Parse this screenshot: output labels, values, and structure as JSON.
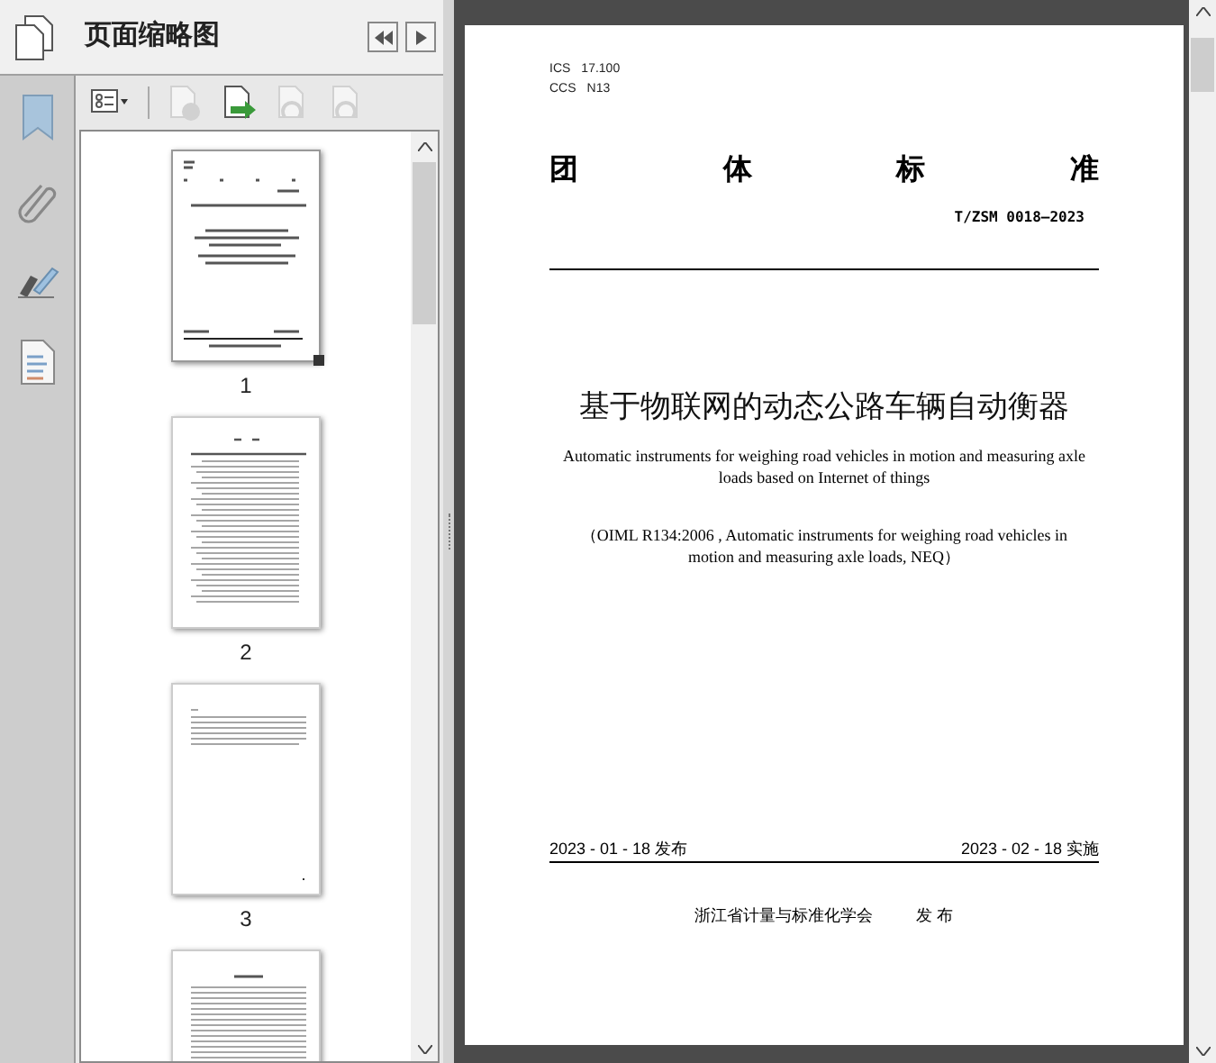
{
  "panel": {
    "title": "页面缩略图"
  },
  "toolbar": [
    {
      "kind": "options",
      "disabled": false
    },
    {
      "kind": "delete",
      "disabled": true
    },
    {
      "kind": "insert",
      "disabled": false
    },
    {
      "kind": "undo",
      "disabled": true
    },
    {
      "kind": "redo",
      "disabled": true
    }
  ],
  "thumbnails": [
    {
      "label": "1",
      "selected": true,
      "kind": "cover"
    },
    {
      "label": "2",
      "selected": false,
      "kind": "toc"
    },
    {
      "label": "3",
      "selected": false,
      "kind": "short"
    },
    {
      "selected": false,
      "kind": "text"
    }
  ],
  "document": {
    "classification": [
      {
        "label": "ICS",
        "value": "17.100"
      },
      {
        "label": "CCS",
        "value": "N13"
      }
    ],
    "heading_chars": [
      "团",
      "体",
      "标",
      "准"
    ],
    "code": "T/ZSM 0018—2023",
    "title_cn": "基于物联网的动态公路车辆自动衡器",
    "title_en": "Automatic instruments for weighing road vehicles in motion and measuring axle loads based on Internet of things",
    "equivalence": "（OIML R134:2006 , Automatic instruments for weighing road vehicles in motion and measuring axle loads, NEQ）",
    "issue_date": "2023 - 01 - 18 发布",
    "effective_date": "2023 - 02 - 18 实施",
    "publisher": "浙江省计量与标准化学会",
    "publish_word": "发 布"
  }
}
